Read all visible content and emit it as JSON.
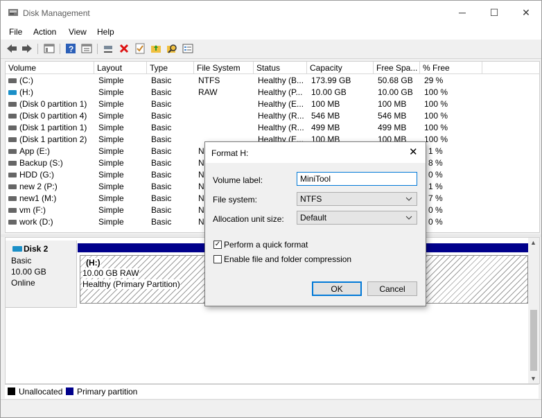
{
  "window": {
    "title": "Disk Management",
    "minimize_glyph": "─",
    "maximize_glyph": "☐",
    "close_glyph": "✕"
  },
  "menu": [
    "File",
    "Action",
    "View",
    "Help"
  ],
  "toolbar_icons": [
    "back-arrow-icon",
    "forward-arrow-icon",
    "console-tree-icon",
    "help-icon",
    "properties-icon",
    "connect-icon",
    "delete-icon",
    "check-icon",
    "folder-up-icon",
    "search-icon",
    "settings-icon"
  ],
  "columns": [
    "Volume",
    "Layout",
    "Type",
    "File System",
    "Status",
    "Capacity",
    "Free Spa...",
    "% Free"
  ],
  "volumes": [
    {
      "name": "(C:)",
      "layout": "Simple",
      "type": "Basic",
      "fs": "NTFS",
      "status": "Healthy (B...",
      "capacity": "173.99 GB",
      "free": "50.68 GB",
      "pct": "29 %"
    },
    {
      "name": "(H:)",
      "layout": "Simple",
      "type": "Basic",
      "fs": "RAW",
      "status": "Healthy (P...",
      "capacity": "10.00 GB",
      "free": "10.00 GB",
      "pct": "100 %"
    },
    {
      "name": "(Disk 0 partition 1)",
      "layout": "Simple",
      "type": "Basic",
      "fs": "",
      "status": "Healthy (E...",
      "capacity": "100 MB",
      "free": "100 MB",
      "pct": "100 %"
    },
    {
      "name": "(Disk 0 partition 4)",
      "layout": "Simple",
      "type": "Basic",
      "fs": "",
      "status": "Healthy (R...",
      "capacity": "546 MB",
      "free": "546 MB",
      "pct": "100 %"
    },
    {
      "name": "(Disk 1 partition 1)",
      "layout": "Simple",
      "type": "Basic",
      "fs": "",
      "status": "Healthy (R...",
      "capacity": "499 MB",
      "free": "499 MB",
      "pct": "100 %"
    },
    {
      "name": "(Disk 1 partition 2)",
      "layout": "Simple",
      "type": "Basic",
      "fs": "",
      "status": "Healthy (E...",
      "capacity": "100 MB",
      "free": "100 MB",
      "pct": "100 %"
    },
    {
      "name": "App (E:)",
      "layout": "Simple",
      "type": "Basic",
      "fs": "N",
      "status": "",
      "capacity": "",
      "free": "",
      "pct": "1 %"
    },
    {
      "name": "Backup (S:)",
      "layout": "Simple",
      "type": "Basic",
      "fs": "N",
      "status": "",
      "capacity": "",
      "free": "",
      "pct": "8 %"
    },
    {
      "name": "HDD (G:)",
      "layout": "Simple",
      "type": "Basic",
      "fs": "N",
      "status": "",
      "capacity": "",
      "free": "",
      "pct": "0 %"
    },
    {
      "name": "new 2 (P:)",
      "layout": "Simple",
      "type": "Basic",
      "fs": "N",
      "status": "",
      "capacity": "",
      "free": "",
      "pct": "1 %"
    },
    {
      "name": "new1 (M:)",
      "layout": "Simple",
      "type": "Basic",
      "fs": "N",
      "status": "",
      "capacity": "",
      "free": "",
      "pct": "7 %"
    },
    {
      "name": "vm (F:)",
      "layout": "Simple",
      "type": "Basic",
      "fs": "N",
      "status": "",
      "capacity": "",
      "free": "",
      "pct": "0 %"
    },
    {
      "name": "work (D:)",
      "layout": "Simple",
      "type": "Basic",
      "fs": "N",
      "status": "",
      "capacity": "",
      "free": "",
      "pct": "0 %"
    }
  ],
  "disk": {
    "name": "Disk 2",
    "kind": "Basic",
    "size": "10.00 GB",
    "state": "Online"
  },
  "partition": {
    "name": "(H:)",
    "size_fs": "10.00 GB RAW",
    "status": "Healthy (Primary Partition)"
  },
  "legend": [
    {
      "label": "Unallocated",
      "color": "#000000"
    },
    {
      "label": "Primary partition",
      "color": "#00008b"
    }
  ],
  "dialog": {
    "title": "Format H:",
    "volume_label_text": "Volume label:",
    "volume_label_value": "MiniTool",
    "file_system_text": "File system:",
    "file_system_value": "NTFS",
    "alloc_text": "Allocation unit size:",
    "alloc_value": "Default",
    "quick_format_text": "Perform a quick format",
    "quick_format_checked": true,
    "compression_text": "Enable file and folder compression",
    "compression_checked": false,
    "ok": "OK",
    "cancel": "Cancel"
  },
  "colors": {
    "primary_partition": "#00008b",
    "selection_accent": "#0078d7"
  }
}
